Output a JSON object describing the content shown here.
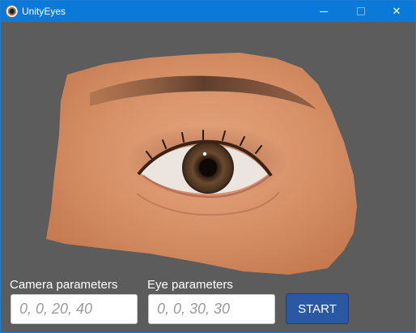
{
  "window": {
    "title": "UnityEyes",
    "icon": "unity-eyes-app-icon",
    "controls": {
      "minimize": "minimize-icon",
      "maximize": "maximize-icon",
      "close": "close-icon"
    }
  },
  "form": {
    "camera_label": "Camera parameters",
    "camera_placeholder": "0, 0, 20, 40",
    "camera_value": "",
    "eye_label": "Eye parameters",
    "eye_placeholder": "0, 0, 30, 30",
    "eye_value": "",
    "start_label": "START"
  },
  "colors": {
    "titlebar": "#0a79d8",
    "background": "#5c5c5c",
    "start_button": "#2a58a2"
  }
}
